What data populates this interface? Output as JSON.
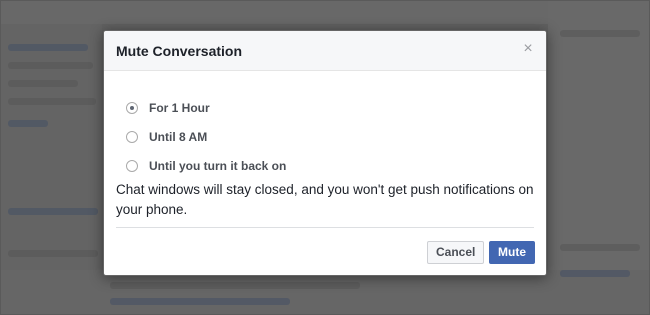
{
  "dialog": {
    "title": "Mute Conversation",
    "close_glyph": "×",
    "options": [
      {
        "label": "For 1 Hour",
        "checked": true
      },
      {
        "label": "Until 8 AM",
        "checked": false
      },
      {
        "label": "Until you turn it back on",
        "checked": false
      }
    ],
    "message": "Chat windows will stay closed, and you won't get push notifications on your phone.",
    "cancel_label": "Cancel",
    "mute_label": "Mute"
  },
  "colors": {
    "primary_button": "#4267b2",
    "header_bg": "#f6f7f9"
  },
  "icons": {
    "close": "close-icon"
  }
}
